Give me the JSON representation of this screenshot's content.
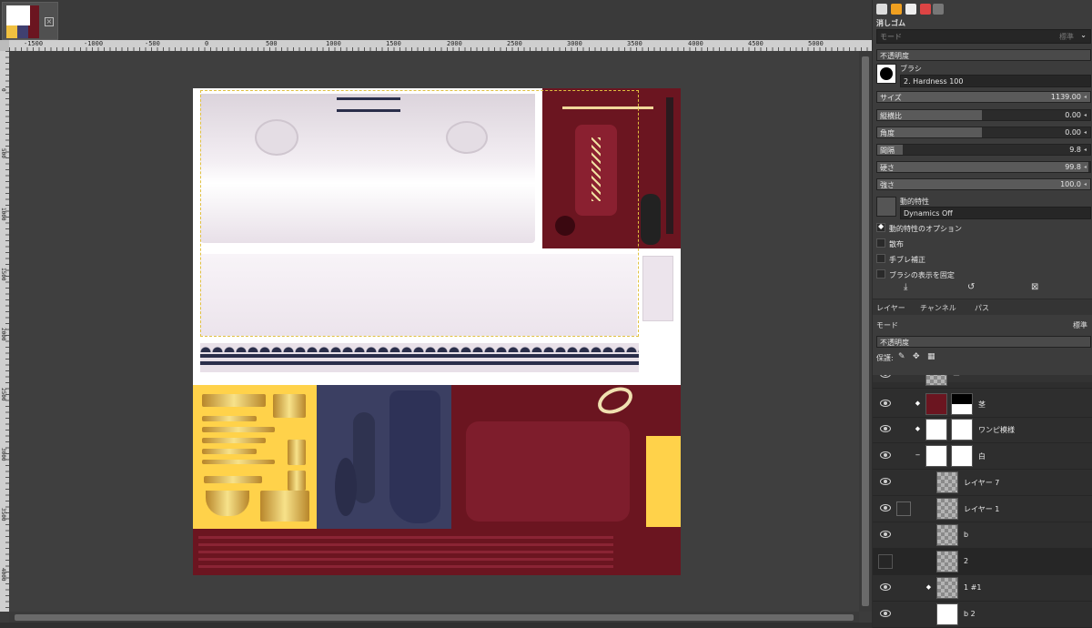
{
  "rulers": {
    "top": [
      "-1500",
      "-1000",
      "-500",
      "0",
      "500",
      "1000",
      "1500",
      "2000",
      "2500",
      "3000",
      "3500",
      "4000",
      "4500",
      "5000",
      "5500"
    ],
    "left": [
      "0",
      "500",
      "1000",
      "1500",
      "2000",
      "2500",
      "3000",
      "3500",
      "4000"
    ]
  },
  "tool_options": {
    "tool_name": "消しゴム",
    "mode_label": "モード",
    "mode_value": "標準",
    "opacity_label": "不透明度",
    "brush_label": "ブラシ",
    "brush_value": "2. Hardness 100",
    "size": {
      "label": "サイズ",
      "value": "1139.00"
    },
    "aspect": {
      "label": "縦横比",
      "value": "0.00"
    },
    "angle": {
      "label": "角度",
      "value": "0.00"
    },
    "spacing": {
      "label": "間隔",
      "value": "9.8"
    },
    "hardness": {
      "label": "硬さ",
      "value": "99.8"
    },
    "force": {
      "label": "強さ",
      "value": "100.0"
    },
    "dynamics_label": "動的特性",
    "dynamics_value": "Dynamics Off",
    "dynamics_options": "動的特性のオプション",
    "scatter": "散布",
    "smooth": "手ブレ補正",
    "lock_brush": "ブラシの表示を固定"
  },
  "layers_panel": {
    "tabs": [
      "レイヤー",
      "チャンネル",
      "パス"
    ],
    "mode_label": "モード",
    "mode_value": "標準",
    "opacity_label": "不透明度",
    "lock_label": "保護:",
    "layers": [
      {
        "name": "ー",
        "visible": true
      },
      {
        "name": "茎",
        "visible": true
      },
      {
        "name": "ワンピ模様",
        "visible": true
      },
      {
        "name": "白",
        "visible": true
      },
      {
        "name": "レイヤー 7",
        "visible": true
      },
      {
        "name": "レイヤー 1",
        "visible": true
      },
      {
        "name": "b",
        "visible": true
      },
      {
        "name": "2",
        "visible": false
      },
      {
        "name": "1 #1",
        "visible": true
      },
      {
        "name": "b 2",
        "visible": true
      }
    ]
  },
  "colors": {
    "accent_yellow": "#ffd24a",
    "crimson": "#6b1520",
    "navy": "#3b3f62",
    "selection": "#e0c040"
  }
}
